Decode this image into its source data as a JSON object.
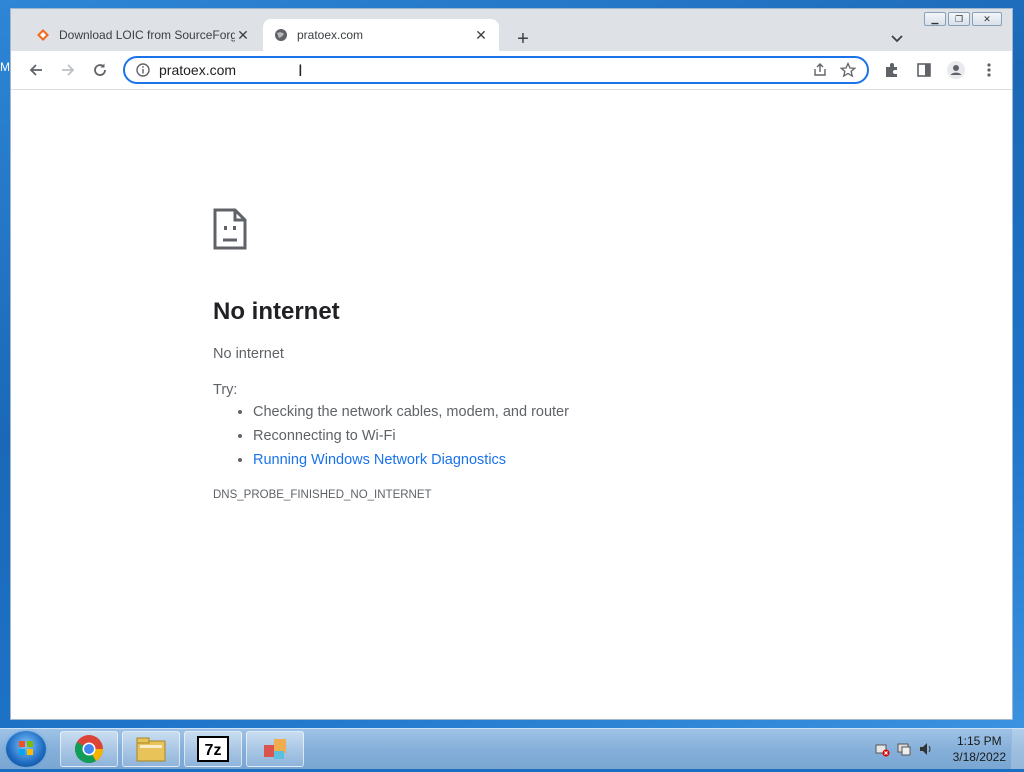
{
  "desktop": {
    "edge_text": "M"
  },
  "browser": {
    "tabs": [
      {
        "title": "Download LOIC from SourceForge.net",
        "favicon": "sourceforge-diamond-icon",
        "active": false
      },
      {
        "title": "pratoex.com",
        "favicon": "globe-icon",
        "active": true
      }
    ],
    "new_tab_label": "+",
    "address": {
      "value": "pratoex.com",
      "info_icon": "info-icon"
    }
  },
  "error_page": {
    "title": "No internet",
    "subtitle": "No internet",
    "try_label": "Try:",
    "suggestions": [
      {
        "text": "Checking the network cables, modem, and router",
        "link": false
      },
      {
        "text": "Reconnecting to Wi-Fi",
        "link": false
      },
      {
        "text": "Running Windows Network Diagnostics",
        "link": true
      }
    ],
    "error_code": "DNS_PROBE_FINISHED_NO_INTERNET"
  },
  "taskbar": {
    "apps": [
      "chrome-icon",
      "file-explorer-icon",
      "7zip-icon",
      "control-panel-icon"
    ],
    "tray": [
      "network-error-icon",
      "action-center-icon",
      "volume-icon"
    ],
    "clock": {
      "time": "1:15 PM",
      "date": "3/18/2022"
    }
  },
  "colors": {
    "accent": "#1a73e8",
    "link": "#1a73e8",
    "text": "#5f6368",
    "heading": "#202124"
  }
}
